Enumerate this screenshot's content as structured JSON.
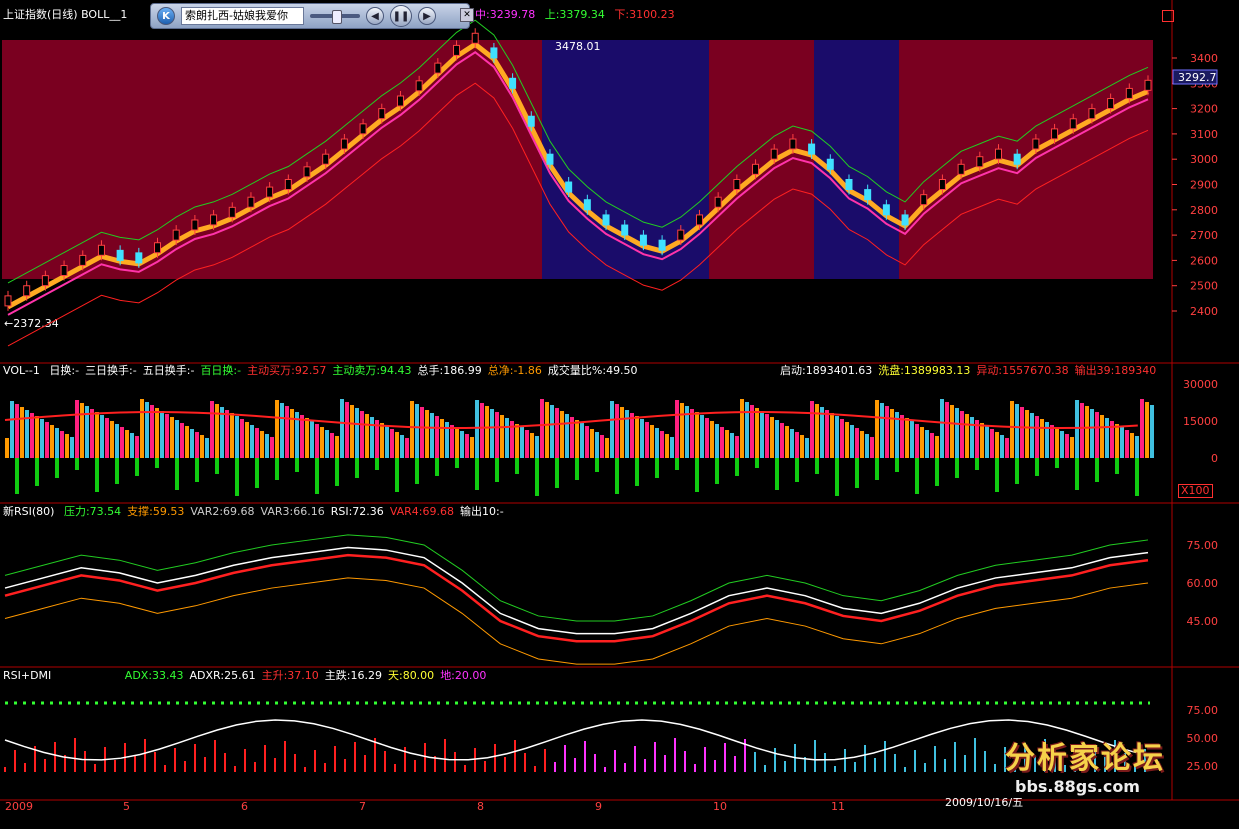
{
  "header": {
    "title": "上证指数(日线) BOLL__1",
    "stat_mid": "中:3239.78",
    "stat_up": "上:3379.34",
    "stat_down": "下:3100.23",
    "peak_label": "3478.01",
    "low_label": "←2372.34",
    "last_price": "3292.7"
  },
  "player": {
    "track_title": "索朗扎西-姑娘我爱你"
  },
  "main_axis": [
    "3400",
    "3300",
    "3200",
    "3100",
    "3000",
    "2900",
    "2800",
    "2700",
    "2600",
    "2500",
    "2400"
  ],
  "vol": {
    "title": "VOL--1",
    "items": [
      {
        "text": "日换:-",
        "color": "#ffffff"
      },
      {
        "text": "三日换手:-",
        "color": "#ffffff"
      },
      {
        "text": "五日换手:-",
        "color": "#ffffff"
      },
      {
        "text": "百日换:-",
        "color": "#33ff33"
      },
      {
        "text": "主动买万:92.57",
        "color": "#ff3030"
      },
      {
        "text": "主动卖万:94.43",
        "color": "#33ff33"
      },
      {
        "text": "总手:186.99",
        "color": "#ffffff"
      },
      {
        "text": "总净:-1.86",
        "color": "#ff9900"
      },
      {
        "text": "成交量比%:49.50",
        "color": "#ffffff"
      }
    ],
    "right_items": [
      {
        "text": "启动:1893401.63",
        "color": "#ffffff"
      },
      {
        "text": "洗盘:1389983.13",
        "color": "#ffff33"
      },
      {
        "text": "异动:1557670.38",
        "color": "#ff3030"
      },
      {
        "text": "输出39:189340",
        "color": "#ff3030"
      }
    ],
    "axis": [
      "30000",
      "15000",
      "0"
    ],
    "unit": "X100"
  },
  "rsi": {
    "title": "新RSI(80)",
    "items": [
      {
        "text": "压力:73.54",
        "color": "#33ff33"
      },
      {
        "text": "支撑:59.53",
        "color": "#ff9900"
      },
      {
        "text": "VAR2:69.68",
        "color": "#cccccc"
      },
      {
        "text": "VAR3:66.16",
        "color": "#cccccc"
      },
      {
        "text": "RSI:72.36",
        "color": "#ffffff"
      },
      {
        "text": "VAR4:69.68",
        "color": "#ff3030"
      },
      {
        "text": "输出10:-",
        "color": "#ffffff"
      }
    ],
    "axis": [
      "75.00",
      "60.00",
      "45.00"
    ]
  },
  "dmi": {
    "title": "RSI+DMI",
    "items": [
      {
        "text": "ADX:33.43",
        "color": "#33ff33"
      },
      {
        "text": "ADXR:25.61",
        "color": "#ffffff"
      },
      {
        "text": "主升:37.10",
        "color": "#ff3030"
      },
      {
        "text": "主跌:16.29",
        "color": "#ffffff"
      },
      {
        "text": "天:80.00",
        "color": "#ffff33"
      },
      {
        "text": "地:20.00",
        "color": "#ff33ff"
      }
    ],
    "axis": [
      "75.00",
      "50.00",
      "25.00"
    ],
    "date_label": "2009/10/16/五"
  },
  "date_axis": [
    "2009",
    "5",
    "6",
    "7",
    "8",
    "9",
    "10",
    "11"
  ],
  "watermark": {
    "line1": "分析家论坛",
    "line2": "bbs.88gs.com"
  }
}
